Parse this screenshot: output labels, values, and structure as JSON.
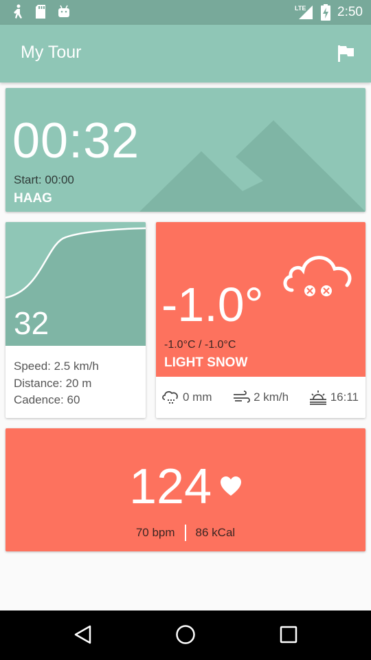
{
  "status_bar": {
    "icons": [
      "walk-icon",
      "sd-card-icon",
      "android-icon"
    ],
    "network": "LTE",
    "time": "2:50"
  },
  "app_bar": {
    "title": "My Tour",
    "action_icon": "flag-icon"
  },
  "timer_card": {
    "elapsed": "00:32",
    "start": "Start: 00:00",
    "place": "HAAG"
  },
  "stats_card": {
    "value": "32",
    "speed": "Speed: 2.5 km/h",
    "distance": "Distance: 20 m",
    "cadence": "Cadence: 60"
  },
  "weather_card": {
    "temperature": "-1.0°",
    "range": "-1.0°C / -1.0°C",
    "condition": "LIGHT SNOW",
    "precipitation": "0 mm",
    "wind": "2 km/h",
    "sunset": "16:11"
  },
  "heart_card": {
    "value": "124",
    "bpm": "70 bpm",
    "calories": "86 kCal"
  },
  "colors": {
    "primary": "#8fc6b6",
    "primary_dark": "#78a99a",
    "accent": "#fd725e"
  }
}
